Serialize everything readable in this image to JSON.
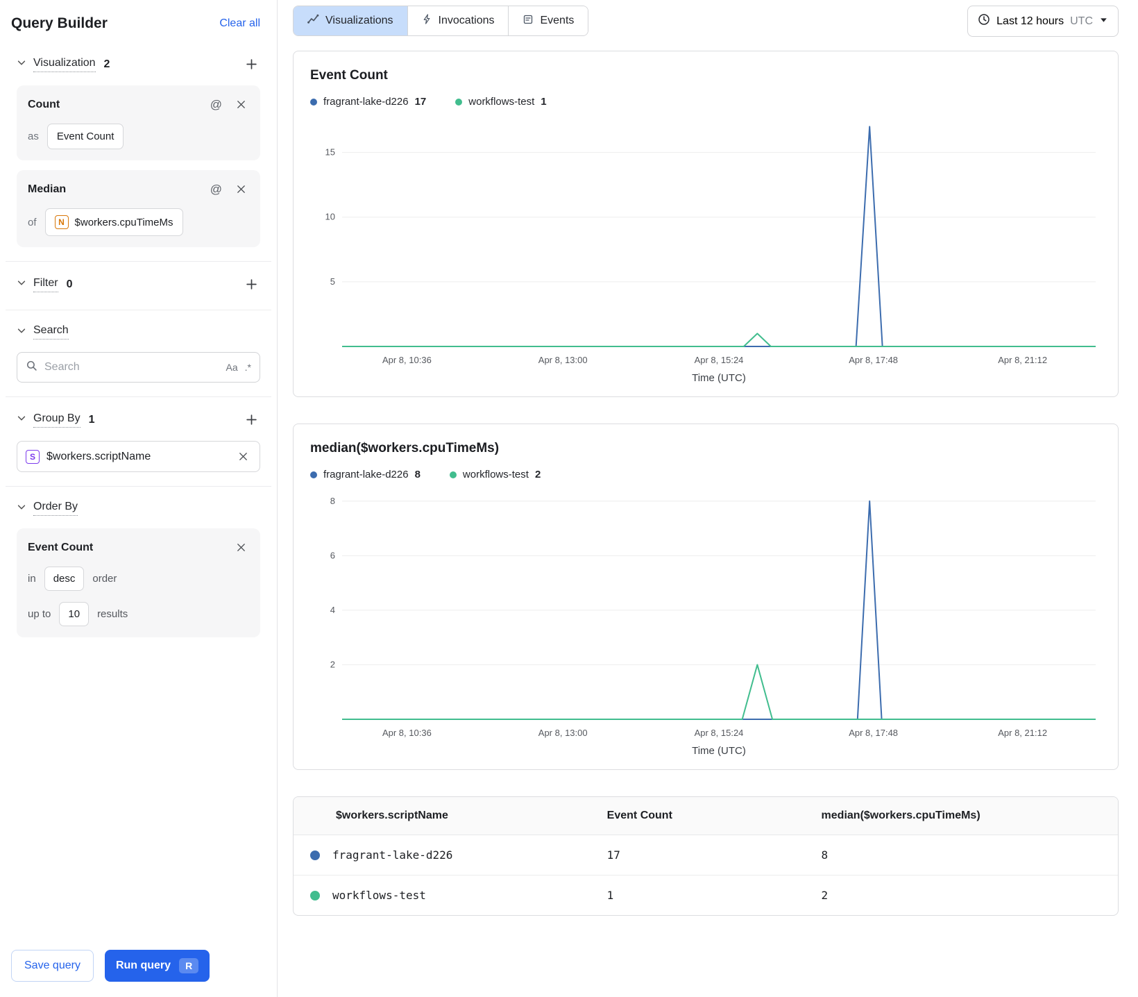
{
  "colors": {
    "accent": "#2563eb",
    "blue": "#3c6cae",
    "green": "#41bd8e"
  },
  "sidebar": {
    "title": "Query Builder",
    "clear_all": "Clear all",
    "visualization": {
      "label": "Visualization",
      "count": "2"
    },
    "count_card": {
      "title": "Count",
      "as_label": "as",
      "value": "Event Count"
    },
    "median_card": {
      "title": "Median",
      "of_label": "of",
      "badge": "N",
      "value": "$workers.cpuTimeMs"
    },
    "filter": {
      "label": "Filter",
      "count": "0"
    },
    "search": {
      "label": "Search",
      "placeholder": "Search",
      "case_tool": "Aa",
      "regex_tool": ".*"
    },
    "group_by": {
      "label": "Group By",
      "count": "1",
      "badge": "S",
      "value": "$workers.scriptName"
    },
    "order_by": {
      "label": "Order By",
      "card_title": "Event Count",
      "in_label": "in",
      "order_value": "desc",
      "order_suffix": "order",
      "upto_label": "up to",
      "limit_value": "10",
      "results_suffix": "results"
    },
    "save_button": "Save query",
    "run_button": "Run query",
    "run_shortcut": "R"
  },
  "tabs": [
    {
      "label": "Visualizations"
    },
    {
      "label": "Invocations"
    },
    {
      "label": "Events"
    }
  ],
  "time_range": {
    "label": "Last 12 hours",
    "timezone": "UTC"
  },
  "chart_data": [
    {
      "type": "line",
      "title": "Event Count",
      "xlabel": "Time (UTC)",
      "x_ticks": [
        "Apr 8, 10:36",
        "Apr 8, 13:00",
        "Apr 8, 15:24",
        "Apr 8, 17:48",
        "Apr 8, 21:12"
      ],
      "x_tick_pos": [
        0.086,
        0.293,
        0.5,
        0.705,
        0.903
      ],
      "y_ticks": [
        5,
        10,
        15
      ],
      "ylim": [
        0,
        17.5
      ],
      "legend": [
        {
          "name": "fragrant-lake-d226",
          "value": "17",
          "color": "blue"
        },
        {
          "name": "workflows-test",
          "value": "1",
          "color": "green"
        }
      ],
      "series": [
        {
          "name": "fragrant-lake-d226",
          "color": "blue",
          "points": [
            [
              0,
              0
            ],
            [
              0.682,
              0
            ],
            [
              0.7,
              17
            ],
            [
              0.717,
              0
            ],
            [
              1,
              0
            ]
          ]
        },
        {
          "name": "workflows-test",
          "color": "green",
          "points": [
            [
              0,
              0
            ],
            [
              0.533,
              0
            ],
            [
              0.551,
              1
            ],
            [
              0.569,
              0
            ],
            [
              1,
              0
            ]
          ]
        }
      ]
    },
    {
      "type": "line",
      "title": "median($workers.cpuTimeMs)",
      "xlabel": "Time (UTC)",
      "x_ticks": [
        "Apr 8, 10:36",
        "Apr 8, 13:00",
        "Apr 8, 15:24",
        "Apr 8, 17:48",
        "Apr 8, 21:12"
      ],
      "x_tick_pos": [
        0.086,
        0.293,
        0.5,
        0.705,
        0.903
      ],
      "y_ticks": [
        2,
        4,
        6,
        8
      ],
      "ylim": [
        0,
        8.3
      ],
      "legend": [
        {
          "name": "fragrant-lake-d226",
          "value": "8",
          "color": "blue"
        },
        {
          "name": "workflows-test",
          "value": "2",
          "color": "green"
        }
      ],
      "series": [
        {
          "name": "fragrant-lake-d226",
          "color": "blue",
          "points": [
            [
              0,
              0
            ],
            [
              0.684,
              0
            ],
            [
              0.7,
              8
            ],
            [
              0.716,
              0
            ],
            [
              1,
              0
            ]
          ]
        },
        {
          "name": "workflows-test",
          "color": "green",
          "points": [
            [
              0,
              0
            ],
            [
              0.531,
              0
            ],
            [
              0.551,
              2
            ],
            [
              0.571,
              0
            ],
            [
              1,
              0
            ]
          ]
        }
      ]
    }
  ],
  "table": {
    "columns": [
      "$workers.scriptName",
      "Event Count",
      "median($workers.cpuTimeMs)"
    ],
    "rows": [
      {
        "color": "blue",
        "name": "fragrant-lake-d226",
        "event_count": "17",
        "median": "8"
      },
      {
        "color": "green",
        "name": "workflows-test",
        "event_count": "1",
        "median": "2"
      }
    ]
  }
}
